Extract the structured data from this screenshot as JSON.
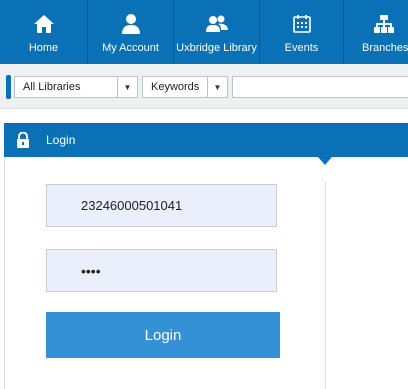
{
  "nav": {
    "items": [
      {
        "label": "Home",
        "icon": "home-icon"
      },
      {
        "label": "My Account",
        "icon": "user-icon"
      },
      {
        "label": "Uxbridge Library",
        "icon": "users-icon"
      },
      {
        "label": "Events",
        "icon": "calendar-icon"
      },
      {
        "label": "Branches",
        "icon": "sitemap-icon"
      }
    ],
    "color": "#0b71b7"
  },
  "search": {
    "library_select": "All Libraries",
    "field_select": "Keywords",
    "query": ""
  },
  "login": {
    "title": "Login",
    "username": "23246000501041",
    "password": "••••",
    "button_label": "Login",
    "button_color": "#3591d6"
  }
}
